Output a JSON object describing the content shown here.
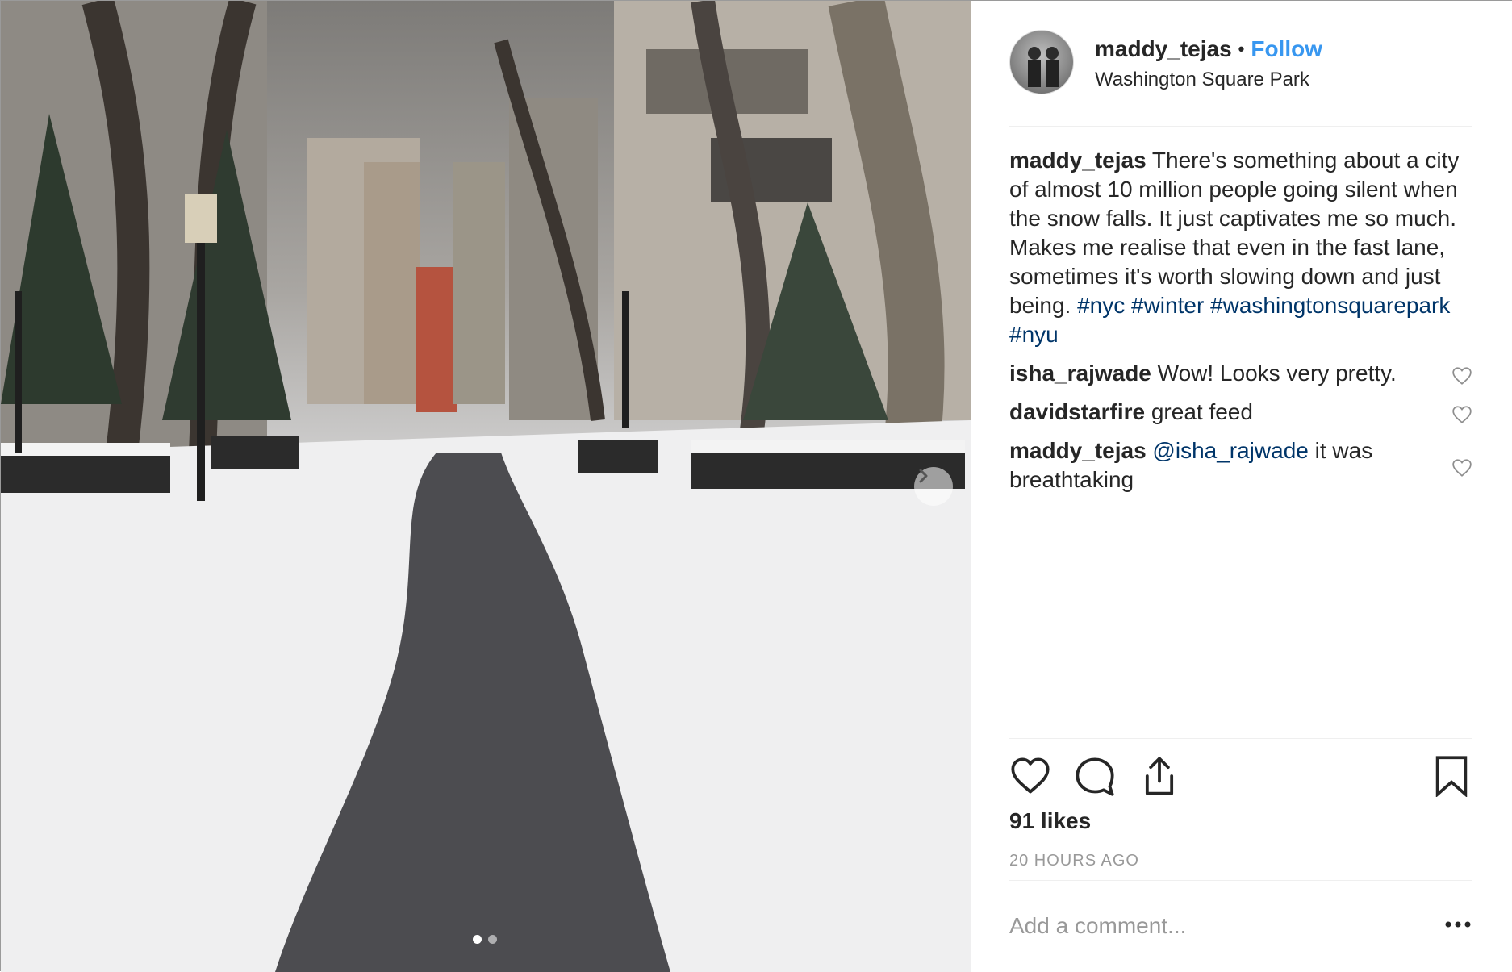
{
  "post": {
    "username": "maddy_tejas",
    "separator": "•",
    "follow_label": "Follow",
    "location": "Washington Square Park",
    "caption_text": " There's something about a city of almost 10 million people going silent when the snow falls. It just captivates me so much. Makes me realise that even in the fast lane, sometimes it's worth slowing down and just being. ",
    "hashtags": [
      "#nyc",
      "#winter",
      "#washingtonsquarepark",
      "#nyu"
    ]
  },
  "comments": [
    {
      "username": "isha_rajwade",
      "mention": "",
      "text": " Wow! Looks very pretty."
    },
    {
      "username": "davidstarfire",
      "mention": "",
      "text": " great feed"
    },
    {
      "username": "maddy_tejas",
      "mention": "@isha_rajwade",
      "text": " it was breathtaking"
    }
  ],
  "likes_label": "91 likes",
  "time_label": "20 HOURS AGO",
  "add_comment_placeholder": "Add a comment...",
  "carousel": {
    "slide_count": 2,
    "active_index": 0
  },
  "colors": {
    "link": "#3897f0",
    "hashtag": "#003569",
    "muted": "#999999",
    "text": "#262626"
  },
  "icons": {
    "like": "heart-outline-icon",
    "comment": "speech-bubble-icon",
    "share": "share-upload-icon",
    "save": "bookmark-icon",
    "more": "ellipsis-icon",
    "next": "chevron-right-icon"
  }
}
